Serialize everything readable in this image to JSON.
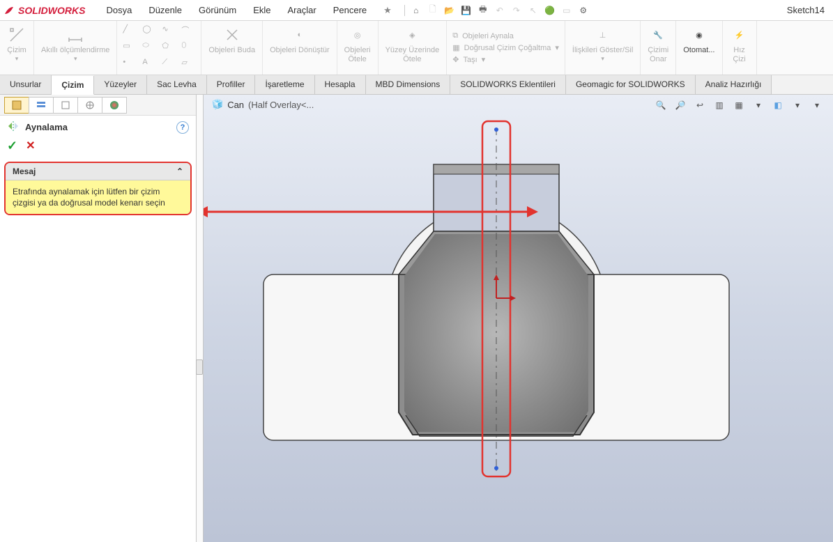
{
  "app": {
    "brand": "SOLIDWORKS",
    "doc_label": "Sketch14"
  },
  "menus": [
    "Dosya",
    "Düzenle",
    "Görünüm",
    "Ekle",
    "Araçlar",
    "Pencere"
  ],
  "ribbon": {
    "cizim": "Çizim",
    "akilli": "Akıllı ölçümlendirme",
    "objeleri_buda": "Objeleri Buda",
    "objeleri_donustur": "Objeleri Dönüştür",
    "objeleri_otele": "Objeleri\nÖtele",
    "yuzey_otele": "Yüzey Üzerinde\nÖtele",
    "objeleri_aynala": "Objeleri Aynala",
    "dogrusal_cogaltma": "Doğrusal Çizim Çoğaltma",
    "tasi": "Taşı",
    "iliskileri": "İlişkileri Göster/Sil",
    "cizimi_onar": "Çizimi\nOnar",
    "otomat": "Otomat...",
    "hiz": "Hız",
    "ciziler": "Çizi"
  },
  "tabs": [
    "Unsurlar",
    "Çizim",
    "Yüzeyler",
    "Sac Levha",
    "Profiller",
    "İşaretleme",
    "Hesapla",
    "MBD Dimensions",
    "SOLIDWORKS Eklentileri",
    "Geomagic for SOLIDWORKS",
    "Analiz Hazırlığı"
  ],
  "pm": {
    "title": "Aynalama",
    "msg_head": "Mesaj",
    "msg_body": "Etrafında aynalamak için lütfen bir çizim çizgisi ya da doğrusal model kenarı seçin"
  },
  "crumb": {
    "name": "Can",
    "detail": "(Half Overlay<..."
  }
}
